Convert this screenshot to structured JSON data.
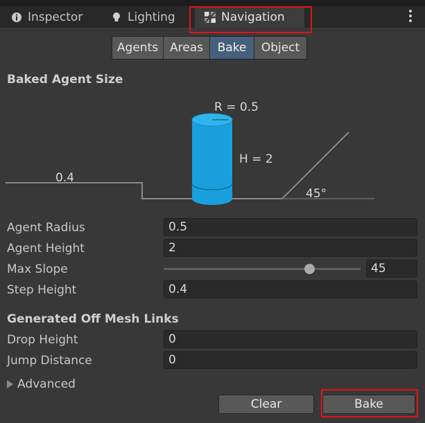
{
  "tabs": [
    {
      "label": "Inspector",
      "icon": "info-icon"
    },
    {
      "label": "Lighting",
      "icon": "bulb-icon"
    },
    {
      "label": "Navigation",
      "icon": "navmesh-icon",
      "active": true
    }
  ],
  "toolbar": {
    "buttons": [
      "Agents",
      "Areas",
      "Bake",
      "Object"
    ],
    "selected": "Bake"
  },
  "baked_agent": {
    "title": "Baked Agent Size",
    "diagram": {
      "radius_label": "R = 0.5",
      "height_label": "H = 2",
      "step_label": "0.4",
      "slope_label": "45°"
    },
    "fields": {
      "agent_radius": {
        "label": "Agent Radius",
        "value": "0.5"
      },
      "agent_height": {
        "label": "Agent Height",
        "value": "2"
      },
      "max_slope": {
        "label": "Max Slope",
        "value": "45"
      },
      "step_height": {
        "label": "Step Height",
        "value": "0.4"
      }
    }
  },
  "off_mesh": {
    "title": "Generated Off Mesh Links",
    "fields": {
      "drop_height": {
        "label": "Drop Height",
        "value": "0"
      },
      "jump_distance": {
        "label": "Jump Distance",
        "value": "0"
      }
    }
  },
  "advanced_label": "Advanced",
  "actions": {
    "clear": "Clear",
    "bake": "Bake"
  },
  "colors": {
    "highlight": "#e0141e",
    "selected_tab": "#46607c",
    "agent_cylinder": "#1aa0dc"
  }
}
